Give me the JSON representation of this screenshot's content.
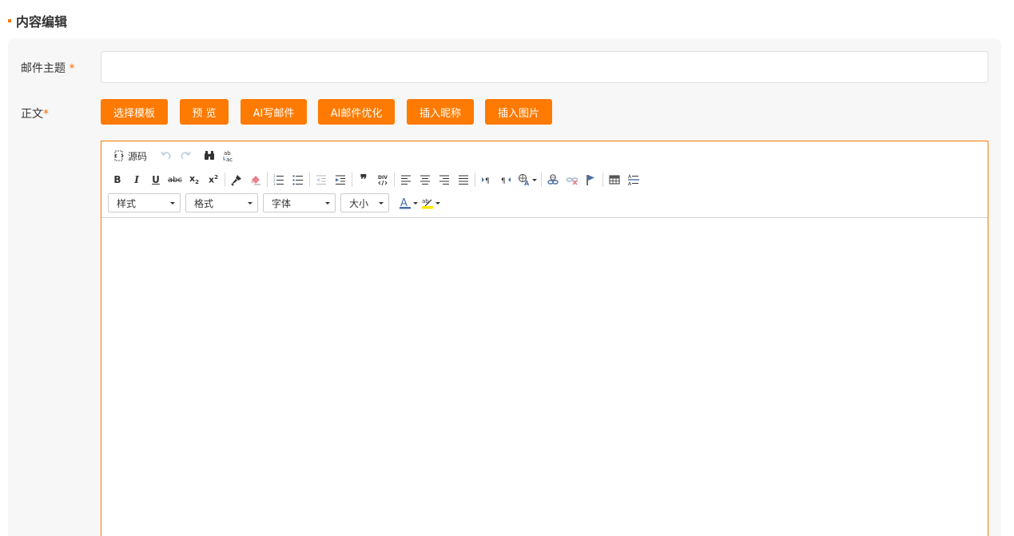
{
  "section": {
    "title": "内容编辑"
  },
  "form": {
    "subject_label": "邮件主题",
    "subject_required": "*",
    "subject_value": "",
    "body_label": "正文",
    "body_required": "*"
  },
  "actions": [
    {
      "label": "选择模板"
    },
    {
      "label": "预 览"
    },
    {
      "label": "AI写邮件"
    },
    {
      "label": "AI邮件优化"
    },
    {
      "label": "插入昵称"
    },
    {
      "label": "插入图片"
    }
  ],
  "editor": {
    "source_label": "源码",
    "combos": {
      "styles": "样式",
      "format": "格式",
      "font": "字体",
      "size": "大小"
    }
  },
  "colors": {
    "accent": "#ff7a00",
    "panel_bg": "#f7f7f7"
  }
}
